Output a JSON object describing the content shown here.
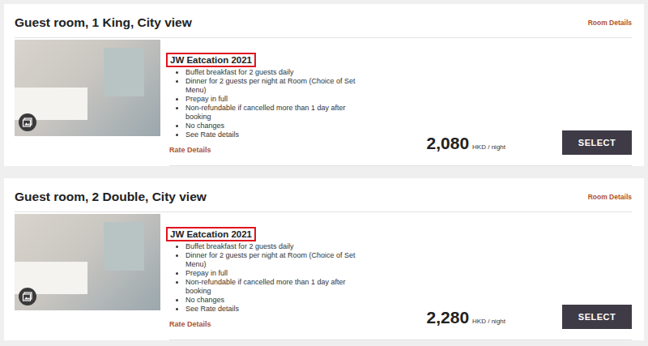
{
  "rooms": [
    {
      "title": "Guest room, 1 King, City view",
      "details_link": "Room Details",
      "rate_name": "JW Eatcation 2021",
      "rate_name_highlighted": true,
      "features": [
        "Buffet breakfast for 2 guests daily",
        "Dinner for 2 guests per night at Room (Choice of Set Menu)",
        "Prepay in full",
        "Non-refundable if cancelled more than 1 day after booking",
        "No changes",
        "See Rate details"
      ],
      "rate_details_link": "Rate Details",
      "price": "2,080",
      "price_unit": "HKD / night",
      "button": "SELECT"
    },
    {
      "title": "Guest room, 2 Double, City view",
      "details_link": "Room Details",
      "rate_name": "JW Eatcation 2021",
      "rate_name_highlighted": true,
      "features": [
        "Buffet breakfast for 2 guests daily",
        "Dinner for 2 guests per night at Room (Choice of Set Menu)",
        "Prepay in full",
        "Non-refundable if cancelled more than 1 day after booking",
        "No changes",
        "See Rate details"
      ],
      "rate_details_link": "Rate Details",
      "price": "2,280",
      "price_unit": "HKD / night",
      "button": "SELECT"
    }
  ]
}
